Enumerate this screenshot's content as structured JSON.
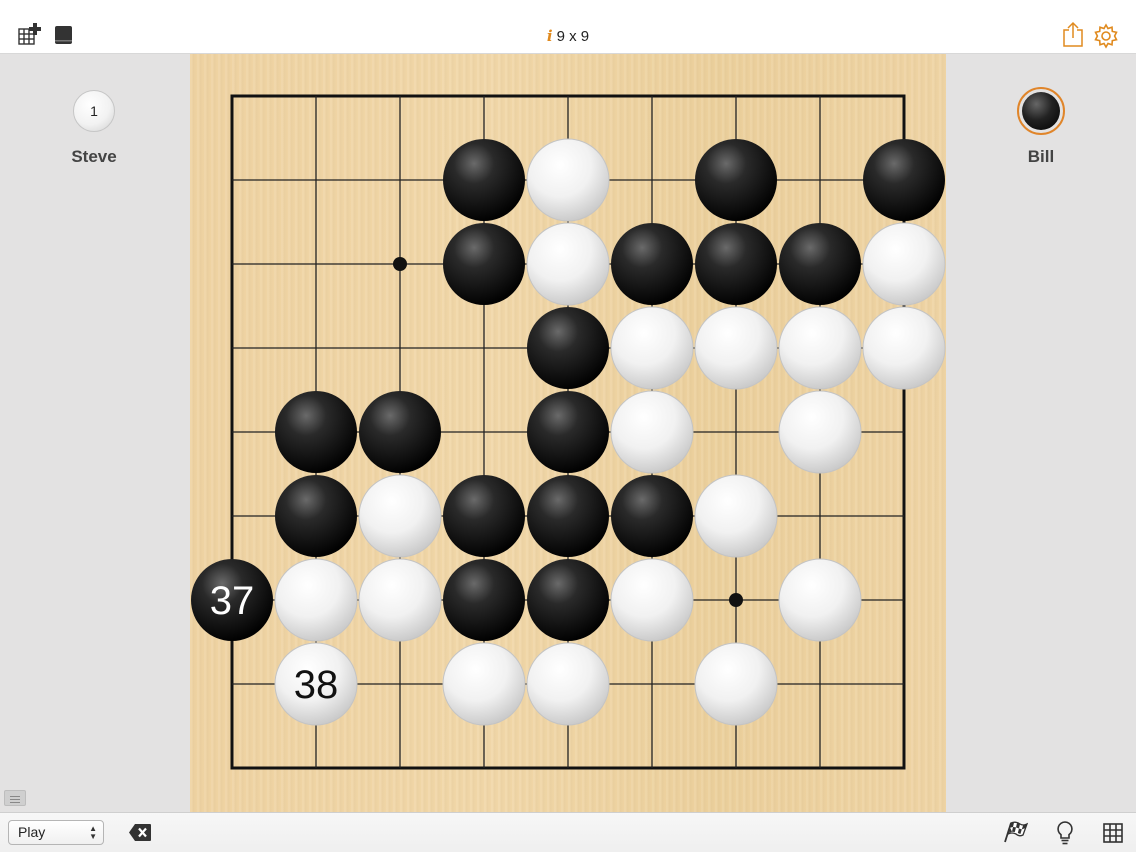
{
  "toolbar": {
    "new_game_icon": "grid-plus-icon",
    "library_icon": "book-icon",
    "share_icon": "share-icon",
    "settings_icon": "gear-icon",
    "accent": "#e08a1e"
  },
  "game": {
    "info_glyph": "i",
    "board_label": "9 x 9"
  },
  "players": {
    "white": {
      "name": "Steve",
      "captures": "1"
    },
    "black": {
      "name": "Bill",
      "to_move": true
    }
  },
  "board": {
    "size": 9,
    "star_points": [
      [
        2,
        2
      ],
      [
        6,
        6
      ]
    ],
    "stones": [
      {
        "col": 3,
        "row": 1,
        "color": "black"
      },
      {
        "col": 4,
        "row": 1,
        "color": "white"
      },
      {
        "col": 6,
        "row": 1,
        "color": "black"
      },
      {
        "col": 8,
        "row": 1,
        "color": "black"
      },
      {
        "col": 3,
        "row": 2,
        "color": "black"
      },
      {
        "col": 4,
        "row": 2,
        "color": "white"
      },
      {
        "col": 5,
        "row": 2,
        "color": "black"
      },
      {
        "col": 6,
        "row": 2,
        "color": "black"
      },
      {
        "col": 7,
        "row": 2,
        "color": "black"
      },
      {
        "col": 8,
        "row": 2,
        "color": "white"
      },
      {
        "col": 4,
        "row": 3,
        "color": "black"
      },
      {
        "col": 5,
        "row": 3,
        "color": "white"
      },
      {
        "col": 6,
        "row": 3,
        "color": "white"
      },
      {
        "col": 7,
        "row": 3,
        "color": "white"
      },
      {
        "col": 8,
        "row": 3,
        "color": "white"
      },
      {
        "col": 1,
        "row": 4,
        "color": "black"
      },
      {
        "col": 2,
        "row": 4,
        "color": "black"
      },
      {
        "col": 4,
        "row": 4,
        "color": "black"
      },
      {
        "col": 5,
        "row": 4,
        "color": "white"
      },
      {
        "col": 7,
        "row": 4,
        "color": "white"
      },
      {
        "col": 1,
        "row": 5,
        "color": "black"
      },
      {
        "col": 2,
        "row": 5,
        "color": "white"
      },
      {
        "col": 3,
        "row": 5,
        "color": "black"
      },
      {
        "col": 4,
        "row": 5,
        "color": "black"
      },
      {
        "col": 5,
        "row": 5,
        "color": "black"
      },
      {
        "col": 6,
        "row": 5,
        "color": "white"
      },
      {
        "col": 0,
        "row": 6,
        "color": "black",
        "label": "37"
      },
      {
        "col": 1,
        "row": 6,
        "color": "white"
      },
      {
        "col": 2,
        "row": 6,
        "color": "white"
      },
      {
        "col": 3,
        "row": 6,
        "color": "black"
      },
      {
        "col": 4,
        "row": 6,
        "color": "black"
      },
      {
        "col": 5,
        "row": 6,
        "color": "white"
      },
      {
        "col": 7,
        "row": 6,
        "color": "white"
      },
      {
        "col": 1,
        "row": 7,
        "color": "white",
        "label": "38"
      },
      {
        "col": 3,
        "row": 7,
        "color": "white"
      },
      {
        "col": 4,
        "row": 7,
        "color": "white"
      },
      {
        "col": 6,
        "row": 7,
        "color": "white"
      }
    ]
  },
  "bottom": {
    "mode": "Play",
    "delete_icon": "delete-icon",
    "resign_icon": "checkered-flag-icon",
    "hint_icon": "lightbulb-icon",
    "grid_icon": "grid-icon"
  }
}
